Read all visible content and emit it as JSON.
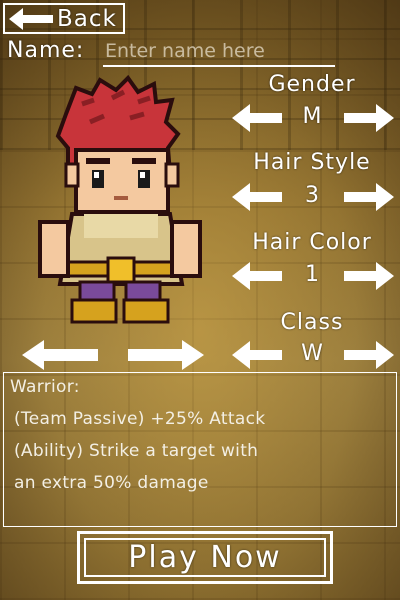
{
  "back": {
    "label": "Back"
  },
  "name": {
    "label": "Name:",
    "placeholder": "Enter name here",
    "value": ""
  },
  "options": {
    "gender": {
      "label": "Gender",
      "value": "M"
    },
    "hair_style": {
      "label": "Hair Style",
      "value": "3"
    },
    "hair_color": {
      "label": "Hair Color",
      "value": "1"
    },
    "class": {
      "label": "Class",
      "value": "W"
    }
  },
  "description": {
    "lines": [
      "Warrior:",
      "(Team Passive) +25% Attack",
      "(Ability) Strike a target with",
      "an extra 50% damage"
    ]
  },
  "play": {
    "label": "Play Now"
  },
  "icons": {
    "left": "arrow-left-icon",
    "right": "arrow-right-icon"
  },
  "colors": {
    "ui_white": "#ffffff",
    "floor": "#a78a45"
  }
}
